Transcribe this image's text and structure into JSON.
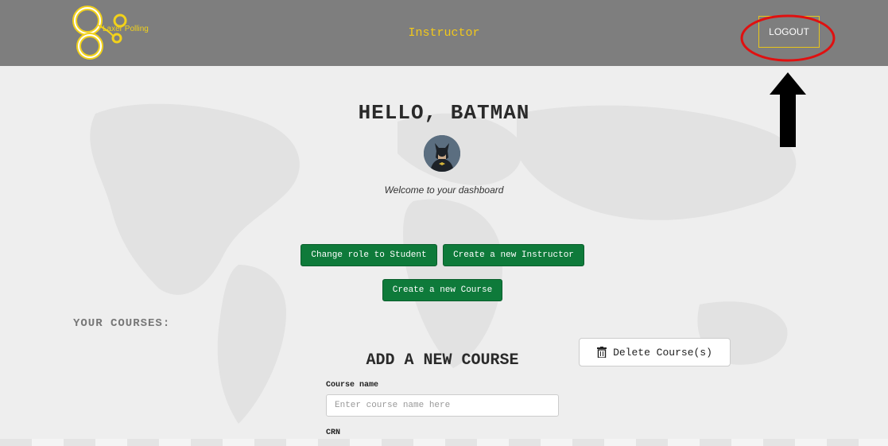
{
  "header": {
    "logo_text": "Laxer Polling",
    "role_title": "Instructor",
    "logout_label": "LOGOUT"
  },
  "greeting": {
    "hello": "HELLO, BATMAN",
    "welcome": "Welcome to your dashboard"
  },
  "actions": {
    "change_role": "Change role to Student",
    "create_instructor": "Create a new Instructor",
    "create_course": "Create a new Course"
  },
  "courses": {
    "heading": "YOUR COURSES:",
    "delete_label": "Delete Course(s)"
  },
  "add_course": {
    "title": "ADD A NEW COURSE",
    "course_name_label": "Course name",
    "course_name_placeholder": "Enter course name here",
    "crn_label": "CRN"
  },
  "colors": {
    "header_bg": "#7e7e7e",
    "accent_yellow": "#f2c81a",
    "button_green": "#0e7a3a",
    "annotation_red": "#e01010"
  }
}
